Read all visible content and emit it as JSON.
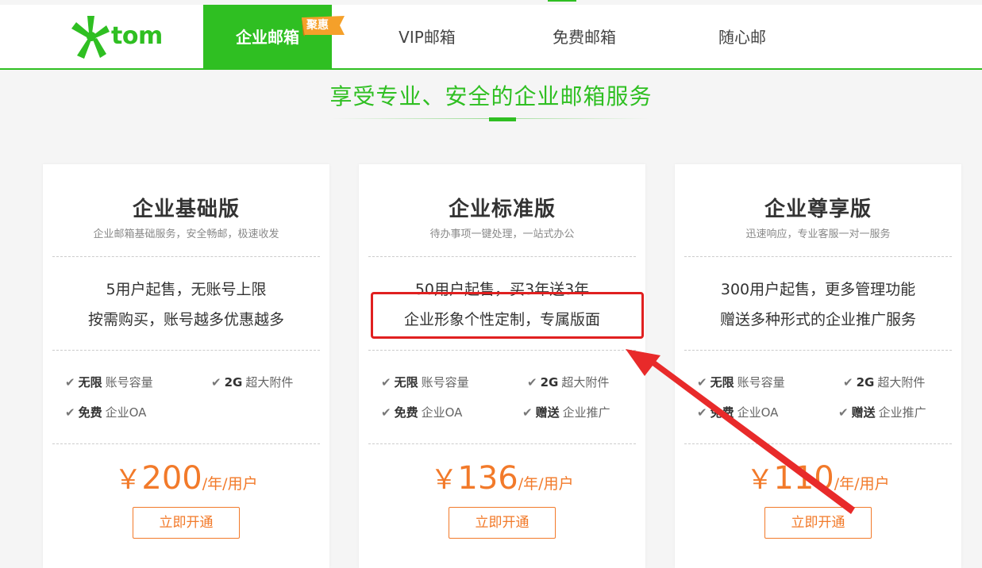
{
  "nav": {
    "brand": "tom",
    "items": [
      {
        "label": "企业邮箱"
      },
      {
        "label": "VIP邮箱"
      },
      {
        "label": "免费邮箱"
      },
      {
        "label": "随心邮"
      }
    ],
    "badge": "聚惠"
  },
  "headline": "享受专业、安全的企业邮箱服务",
  "plans": [
    {
      "title": "企业基础版",
      "subtitle": "企业邮箱基础服务，安全畅邮，极速收发",
      "desc1": "5用户起售，无账号上限",
      "desc2": "按需购买，账号越多优惠越多",
      "features": [
        {
          "bold": "无限",
          "text": "账号容量"
        },
        {
          "bold": "2G",
          "text": "超大附件"
        },
        {
          "bold": "免费",
          "text": "企业OA"
        }
      ],
      "price_currency": "￥",
      "price": "200",
      "price_unit": "/年/用户",
      "button": "立即开通"
    },
    {
      "title": "企业标准版",
      "subtitle": "待办事项一键处理，一站式办公",
      "desc1": "50用户起售，买3年送3年",
      "desc2": "企业形象个性定制，专属版面",
      "features": [
        {
          "bold": "无限",
          "text": "账号容量"
        },
        {
          "bold": "2G",
          "text": "超大附件"
        },
        {
          "bold": "免费",
          "text": "企业OA"
        },
        {
          "bold": "赠送",
          "text": "企业推广"
        }
      ],
      "price_currency": "￥",
      "price": "136",
      "price_unit": "/年/用户",
      "button": "立即开通"
    },
    {
      "title": "企业尊享版",
      "subtitle": "迅速响应，专业客服一对一服务",
      "desc1": "300用户起售，更多管理功能",
      "desc2": "赠送多种形式的企业推广服务",
      "features": [
        {
          "bold": "无限",
          "text": "账号容量"
        },
        {
          "bold": "2G",
          "text": "超大附件"
        },
        {
          "bold": "免费",
          "text": "企业OA"
        },
        {
          "bold": "赠送",
          "text": "企业推广"
        }
      ],
      "price_currency": "￥",
      "price": "110",
      "price_unit": "/年/用户",
      "button": "立即开通"
    }
  ],
  "colors": {
    "brand_green": "#2fbf22",
    "price_orange": "#f27a2a",
    "annotation_red": "#e02020"
  },
  "icons": {
    "check": "check-icon",
    "logo": "tom-logo-icon"
  }
}
